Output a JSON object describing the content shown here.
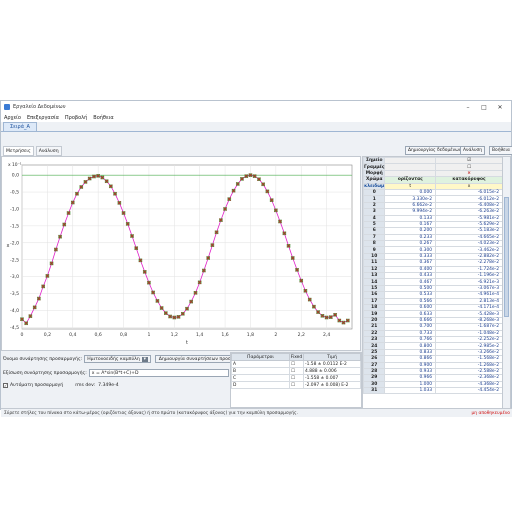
{
  "window": {
    "title": "Εργαλείο Δεδομένων"
  },
  "menu": [
    "Αρχείο",
    "Επεξεργασία",
    "Προβολή",
    "Βοήθεια"
  ],
  "tabs": [
    {
      "label": "Σειρά_A"
    }
  ],
  "subtabs": [
    {
      "label": "Μετρήσεις"
    },
    {
      "label": "Ανάλυση"
    }
  ],
  "toolbar": {
    "create_dataset": "Δημιουργίας δεδομένων...",
    "analysis": "Ανάλυση",
    "help": "Βοήθεια"
  },
  "chart_data": {
    "type": "scatter",
    "title": "",
    "xlabel": "t",
    "ylabel": "x",
    "y_multiplier_label": "x 10⁻¹",
    "xlim": [
      0,
      2.6
    ],
    "ylim": [
      -4.55,
      0.3
    ],
    "xticks": [
      "0",
      "0,2",
      "0,4",
      "0,6",
      "0,8",
      "1",
      "1,2",
      "1,4",
      "1,6",
      "1,8",
      "2",
      "2,2",
      "2,4"
    ],
    "yticks": [
      "0,0",
      "-0,5",
      "-1,0",
      "-1,5",
      "-2,0",
      "-2,5",
      "-3,0",
      "-3,5",
      "-4,0",
      "-4,5"
    ],
    "grid": true,
    "fit": {
      "A": -1.58,
      "B": 4.888,
      "C": -1.558,
      "D": -2.097,
      "color": "#e020c8"
    },
    "reference_line_y": 0,
    "series": [
      {
        "name": "",
        "color": "#3b9a3b",
        "marker": "square",
        "x": [
          0.0,
          0.033,
          0.066,
          0.1,
          0.133,
          0.167,
          0.2,
          0.233,
          0.267,
          0.3,
          0.333,
          0.367,
          0.4,
          0.433,
          0.467,
          0.5,
          0.533,
          0.567,
          0.6,
          0.633,
          0.667,
          0.7,
          0.733,
          0.767,
          0.8,
          0.833,
          0.867,
          0.9,
          0.933,
          0.967,
          1.0,
          1.033,
          1.067,
          1.1,
          1.133,
          1.167,
          1.2,
          1.233,
          1.267,
          1.3,
          1.333,
          1.367,
          1.4,
          1.433,
          1.467,
          1.5,
          1.533,
          1.567,
          1.6,
          1.633,
          1.667,
          1.7,
          1.733,
          1.767,
          1.8,
          1.833,
          1.867,
          1.9,
          1.933,
          1.967,
          2.0,
          2.033,
          2.067,
          2.1,
          2.133,
          2.167,
          2.2,
          2.233,
          2.267,
          2.3,
          2.333,
          2.367,
          2.4,
          2.433,
          2.467,
          2.5,
          2.533,
          2.567
        ],
        "y": [
          -4.26,
          -4.38,
          -4.17,
          -3.91,
          -3.65,
          -3.29,
          -2.98,
          -2.61,
          -2.2,
          -1.82,
          -1.46,
          -1.12,
          -0.81,
          -0.55,
          -0.35,
          -0.2,
          -0.1,
          -0.04,
          -0.02,
          -0.07,
          -0.18,
          -0.33,
          -0.55,
          -0.82,
          -1.12,
          -1.44,
          -1.8,
          -2.16,
          -2.52,
          -2.86,
          -3.18,
          -3.47,
          -3.72,
          -3.93,
          -4.08,
          -4.18,
          -4.21,
          -4.19,
          -4.1,
          -3.95,
          -3.74,
          -3.48,
          -3.17,
          -2.82,
          -2.45,
          -2.07,
          -1.69,
          -1.33,
          -1.0,
          -0.71,
          -0.46,
          -0.26,
          -0.11,
          -0.03,
          0.0,
          -0.03,
          -0.12,
          -0.27,
          -0.48,
          -0.74,
          -1.04,
          -1.37,
          -1.72,
          -2.09,
          -2.45,
          -2.8,
          -3.12,
          -3.42,
          -3.68,
          -3.89,
          -4.05,
          -4.16,
          -4.21,
          -4.2,
          -4.13,
          -4.3,
          -4.36,
          -4.3
        ]
      },
      {
        "name": "",
        "color": "#c02020",
        "marker": "cross",
        "x": [
          0.0,
          0.033,
          0.066,
          0.1,
          0.133,
          0.167,
          0.2,
          0.233,
          0.267,
          0.3,
          0.333,
          0.367,
          0.4,
          0.433,
          0.467,
          0.5,
          0.533,
          0.567,
          0.6,
          0.633,
          0.667,
          0.7,
          0.733,
          0.767,
          0.8,
          0.833,
          0.867,
          0.9,
          0.933,
          0.967,
          1.0,
          1.033,
          1.067,
          1.1,
          1.133,
          1.167,
          1.2,
          1.233,
          1.267,
          1.3,
          1.333,
          1.367,
          1.4,
          1.433,
          1.467,
          1.5,
          1.533,
          1.567,
          1.6,
          1.633,
          1.667,
          1.7,
          1.733,
          1.767,
          1.8,
          1.833,
          1.867,
          1.9,
          1.933,
          1.967,
          2.0,
          2.033,
          2.067,
          2.1,
          2.133,
          2.167,
          2.2,
          2.233,
          2.267,
          2.3,
          2.333,
          2.367,
          2.4,
          2.433,
          2.467,
          2.5,
          2.533,
          2.567
        ],
        "y": [
          -4.26,
          -4.38,
          -4.17,
          -3.91,
          -3.65,
          -3.29,
          -2.98,
          -2.61,
          -2.2,
          -1.82,
          -1.46,
          -1.12,
          -0.81,
          -0.55,
          -0.35,
          -0.2,
          -0.1,
          -0.04,
          -0.02,
          -0.07,
          -0.18,
          -0.33,
          -0.55,
          -0.82,
          -1.12,
          -1.44,
          -1.8,
          -2.16,
          -2.52,
          -2.86,
          -3.18,
          -3.47,
          -3.72,
          -3.93,
          -4.08,
          -4.18,
          -4.21,
          -4.19,
          -4.1,
          -3.95,
          -3.74,
          -3.48,
          -3.17,
          -2.82,
          -2.45,
          -2.07,
          -1.69,
          -1.33,
          -1.0,
          -0.71,
          -0.46,
          -0.26,
          -0.11,
          -0.03,
          0.0,
          -0.03,
          -0.12,
          -0.27,
          -0.48,
          -0.74,
          -1.04,
          -1.37,
          -1.72,
          -2.09,
          -2.45,
          -2.8,
          -3.12,
          -3.42,
          -3.68,
          -3.89,
          -4.05,
          -4.16,
          -4.21,
          -4.2,
          -4.13,
          -4.3,
          -4.36,
          -4.3
        ]
      }
    ]
  },
  "fit_panel": {
    "fit_function_label": "Όνομα συνάρτησης προσαρμογής:",
    "fit_function_value": "Ημιτονοειδής καμπύλη",
    "create_fit_button": "Δημιουργία συναρτήσεων προσαρμογής...",
    "equation_label": "Εξίσωση συνάρτησης προσαρμογής:",
    "equation_value": "x = A*sin(B*t+C)+D",
    "autofit_label": "Αυτόματη προσαρμογή",
    "rms_label": "rms dev:",
    "rms_value": "7.349e-4"
  },
  "params": {
    "headers": [
      "Παράμετροι",
      "Fixed",
      "Τιμή"
    ],
    "rows": [
      {
        "name": "A",
        "value": "-1.58 ± 0.0112 E-2"
      },
      {
        "name": "B",
        "value": "4.888 ± 0.006"
      },
      {
        "name": "C",
        "value": "-1.558 ± 0.007"
      },
      {
        "name": "D",
        "value": "-2.097 ± 0.008) E-2"
      }
    ]
  },
  "data_table": {
    "header_rows": [
      [
        "Σημείο",
        "",
        ""
      ],
      [
        "Γραμμές",
        "",
        "☐"
      ],
      [
        "Μορφή",
        "",
        "×"
      ],
      [
        "Χρώμα",
        "ορίζοντας",
        "κατακόρυφος"
      ]
    ],
    "columns": [
      "t",
      "x"
    ],
    "row_label": "κλειδωμ",
    "rows": [
      [
        "0",
        "0.000",
        "-6.015e-2"
      ],
      [
        "1",
        "3.330e-2",
        "-6.012e-2"
      ],
      [
        "2",
        "6.662e-2",
        "-6.408e-2"
      ],
      [
        "3",
        "9.994e-2",
        "-6.263e-2"
      ],
      [
        "4",
        "0.133",
        "-5.981e-2"
      ],
      [
        "5",
        "0.167",
        "-5.629e-2"
      ],
      [
        "6",
        "0.200",
        "-5.183e-2"
      ],
      [
        "7",
        "0.233",
        "-4.665e-2"
      ],
      [
        "8",
        "0.267",
        "-4.023e-2"
      ],
      [
        "9",
        "0.300",
        "-3.462e-2"
      ],
      [
        "10",
        "0.333",
        "-2.882e-2"
      ],
      [
        "11",
        "0.367",
        "-2.278e-2"
      ],
      [
        "12",
        "0.400",
        "-1.724e-2"
      ],
      [
        "13",
        "0.433",
        "-1.196e-2"
      ],
      [
        "14",
        "0.467",
        "-6.921e-3"
      ],
      [
        "15",
        "0.500",
        "-3.067e-3"
      ],
      [
        "16",
        "0.533",
        "-4.961e-4"
      ],
      [
        "17",
        "0.566",
        "2.813e-4"
      ],
      [
        "18",
        "0.600",
        "-4.171e-4"
      ],
      [
        "19",
        "0.633",
        "-5.428e-3"
      ],
      [
        "20",
        "0.666",
        "-8.268e-3"
      ],
      [
        "21",
        "0.700",
        "-1.687e-2"
      ],
      [
        "22",
        "0.733",
        "-1.048e-2"
      ],
      [
        "23",
        "0.766",
        "-2.252e-2"
      ],
      [
        "24",
        "0.800",
        "-2.985e-2"
      ],
      [
        "25",
        "0.833",
        "-3.266e-2"
      ],
      [
        "26",
        "0.866",
        "-1.568e-2"
      ],
      [
        "27",
        "0.900",
        "-1.268e-2"
      ],
      [
        "28",
        "0.933",
        "-2.588e-2"
      ],
      [
        "29",
        "0.966",
        "-2.368e-2"
      ],
      [
        "30",
        "1.000",
        "-4.368e-2"
      ],
      [
        "31",
        "1.033",
        "-4.454e-2"
      ]
    ]
  },
  "status": {
    "hint": "Σύρετε στήλες του πίνακα στο κάτω-μέρος (οριζόντιος άξονας) ή στο πρώτο (κατακόρυφος άξονας) για την καμπύλη προσαρμογής.",
    "right": "μη αποθηκευμένο"
  }
}
